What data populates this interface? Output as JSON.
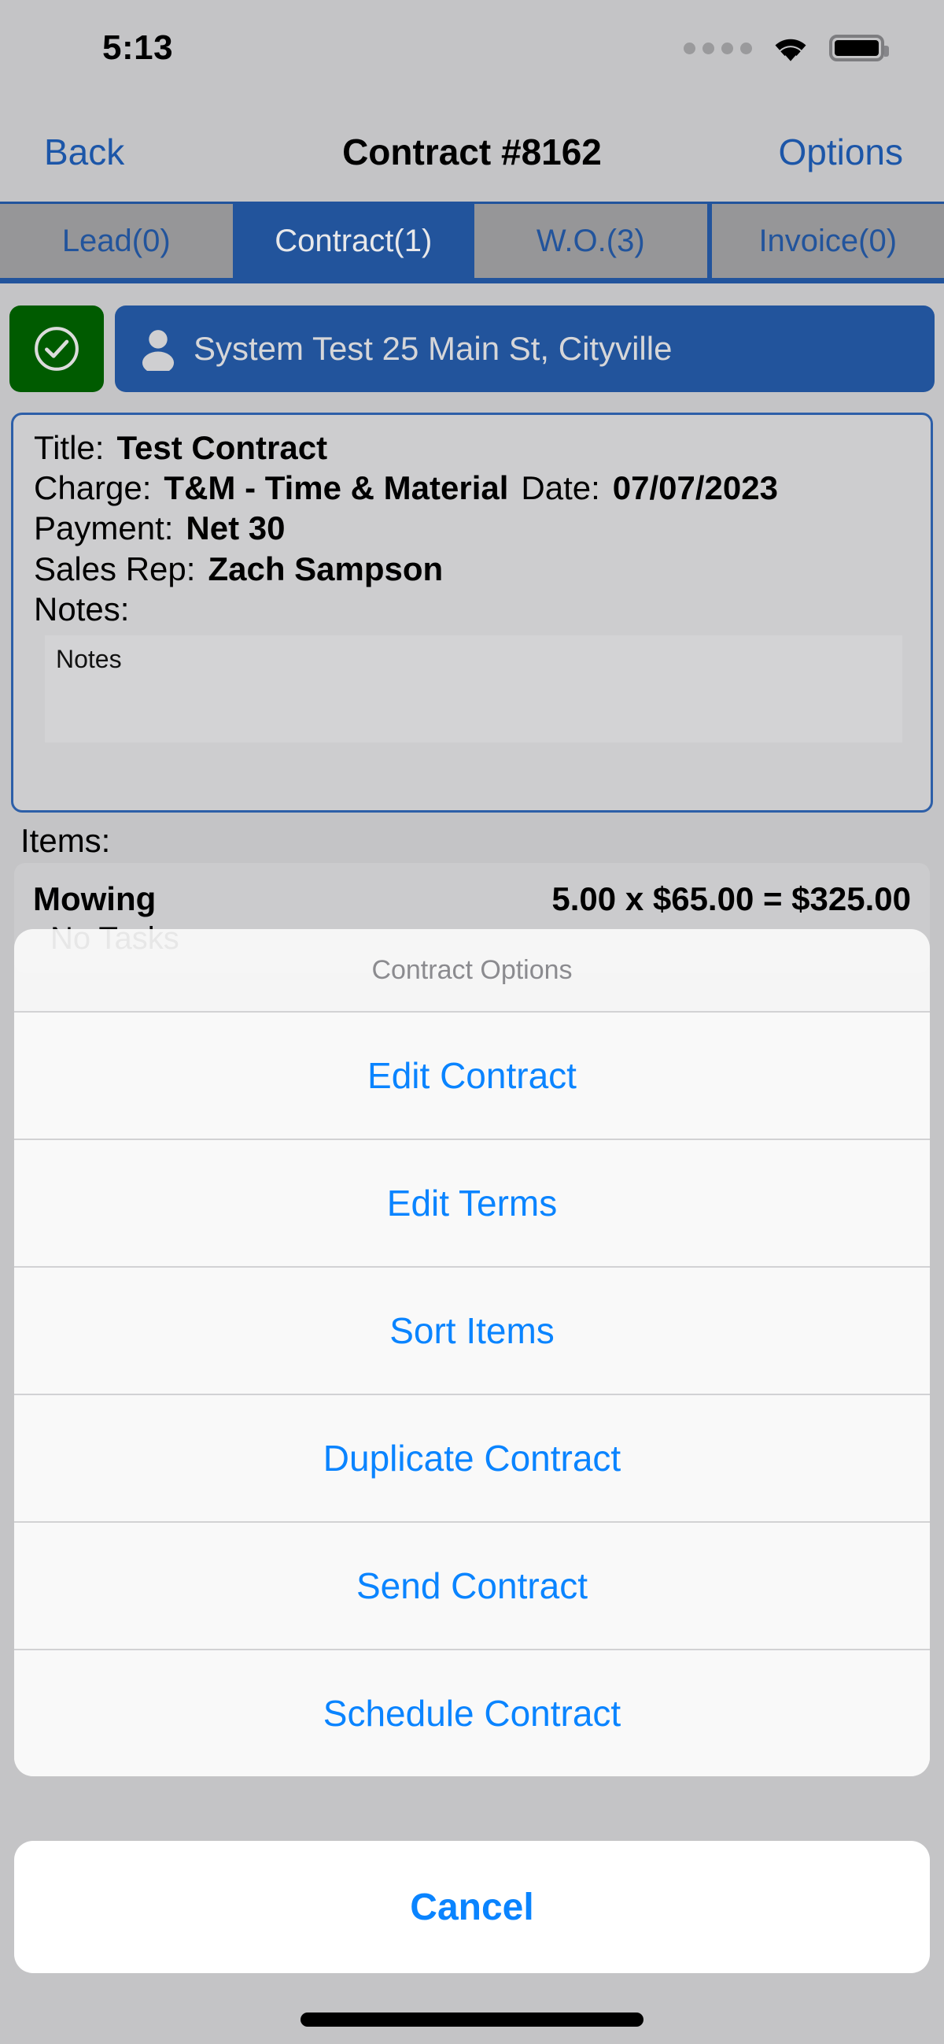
{
  "status_bar": {
    "time": "5:13",
    "signal_icon": "signal-dots-icon",
    "wifi_icon": "wifi-icon",
    "battery_icon": "battery-full-icon"
  },
  "nav_bar": {
    "back_label": "Back",
    "title": "Contract #8162",
    "options_label": "Options"
  },
  "tabs": [
    {
      "label": "Lead(0)",
      "active": false
    },
    {
      "label": "Contract(1)",
      "active": true
    },
    {
      "label": "W.O.(3)",
      "active": false
    },
    {
      "label": "Invoice(0)",
      "active": false
    }
  ],
  "customer": {
    "status_icon": "check-circle-icon",
    "person_icon": "person-icon",
    "name": "System Test 25 Main St, Cityville"
  },
  "details": {
    "title_label": "Title:",
    "title_value": "Test Contract",
    "charge_label": "Charge:",
    "charge_value": "T&M - Time & Material",
    "date_label": "Date:",
    "date_value": "07/07/2023",
    "payment_label": "Payment:",
    "payment_value": "Net 30",
    "sales_rep_label": "Sales Rep:",
    "sales_rep_value": "Zach Sampson",
    "notes_label": "Notes:",
    "notes_value": "",
    "notes_placeholder": "Notes"
  },
  "items": {
    "section_label": "Items:",
    "rows": [
      {
        "name": "Mowing",
        "calc": "5.00 x $65.00 = $325.00",
        "tasks": "No Tasks"
      }
    ]
  },
  "action_sheet": {
    "title": "Contract Options",
    "options": [
      {
        "label": "Edit Contract"
      },
      {
        "label": "Edit Terms"
      },
      {
        "label": "Sort Items"
      },
      {
        "label": "Duplicate Contract"
      },
      {
        "label": "Send Contract"
      },
      {
        "label": "Schedule Contract"
      }
    ],
    "cancel_label": "Cancel"
  },
  "colors": {
    "background": "#c4c4c6",
    "accent_blue": "#22549c",
    "link_blue": "#0a84ff",
    "nav_link_blue": "#1c56a8",
    "status_green": "#005b00",
    "tab_inactive_gray": "#969698",
    "sheet_gray": "#f9f9f9"
  }
}
